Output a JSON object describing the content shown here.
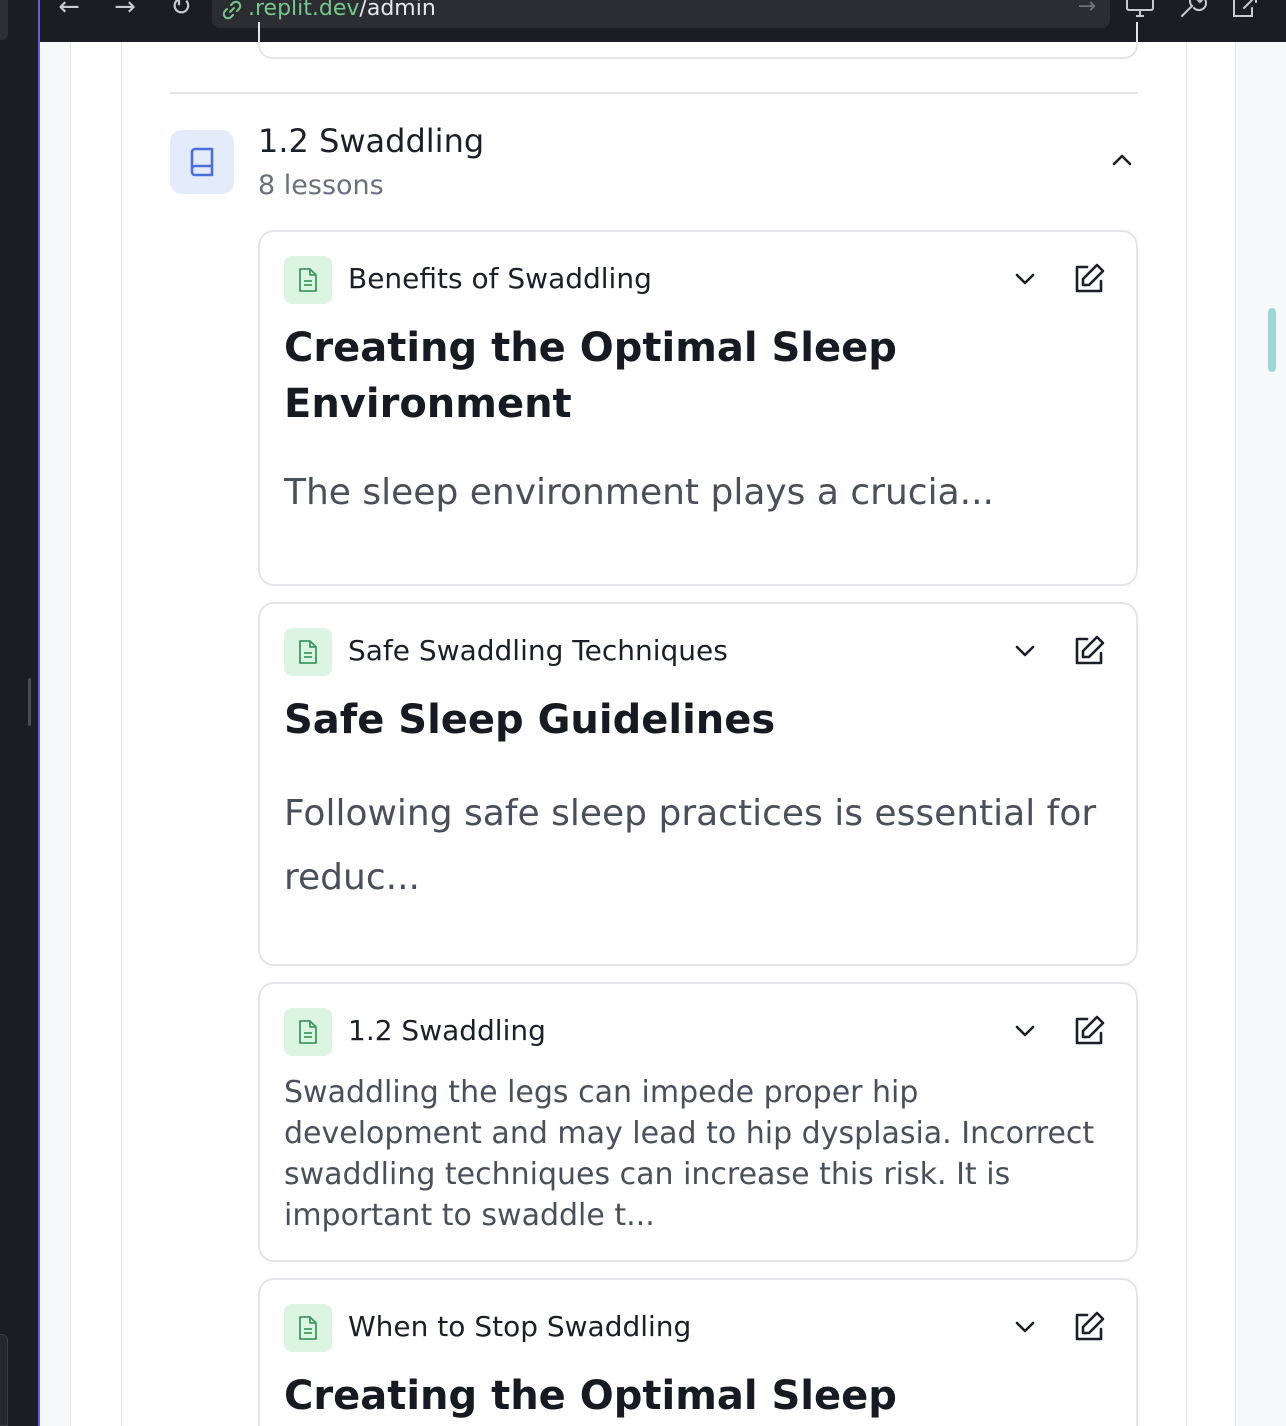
{
  "browser": {
    "url_host": ".replit.dev",
    "url_path": "/admin",
    "back_glyph": "←",
    "forward_glyph": "→",
    "reload_glyph": "↻",
    "go_glyph": "→"
  },
  "module": {
    "title": "1.2 Swaddling",
    "lesson_count": "8 lessons",
    "icon": "book-icon",
    "expanded": true
  },
  "lessons": [
    {
      "title": "Benefits of Swaddling",
      "heading": "Creating the Optimal Sleep Environment",
      "body": "The sleep environment plays a crucia..."
    },
    {
      "title": "Safe Swaddling Techniques",
      "heading": "Safe Sleep Guidelines",
      "body": "Following safe sleep practices is essential for reduc..."
    },
    {
      "title": "1.2 Swaddling",
      "heading": "",
      "body": "Swaddling the legs can impede proper hip development and may lead to hip dysplasia. Incorrect swaddling techniques can increase this risk. It is important to swaddle t..."
    },
    {
      "title": "When to Stop Swaddling",
      "heading": "Creating the Optimal Sleep",
      "body": ""
    }
  ],
  "colors": {
    "accent_blue": "#4a6fdc",
    "doc_green": "#3c9a5f",
    "frame_purple": "#6b5bd6"
  }
}
